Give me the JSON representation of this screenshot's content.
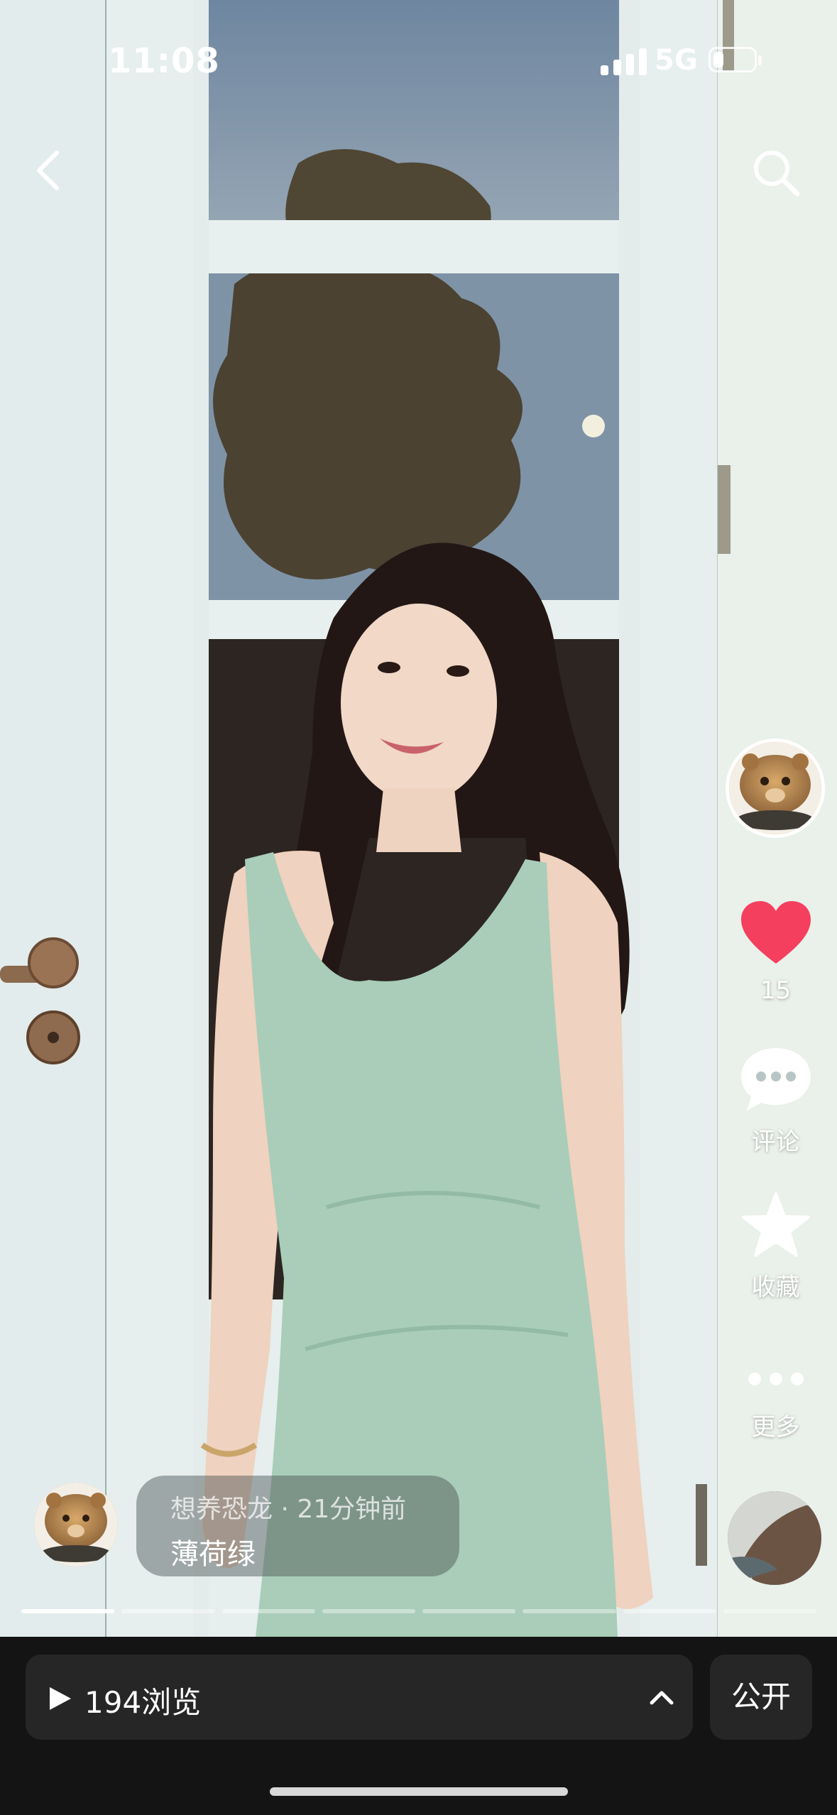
{
  "status_bar": {
    "time": "11:08",
    "network": "5G",
    "battery_level": 0.2
  },
  "post": {
    "author": "想养恐龙",
    "time_ago": "21分钟前",
    "meta_line": "想养恐龙 · 21分钟前",
    "title": "薄荷绿",
    "segments_total": 8,
    "segment_active": 1
  },
  "actions": {
    "like_count": "15",
    "comment_label": "评论",
    "favorite_label": "收藏",
    "more_label": "更多"
  },
  "bottom_bar": {
    "views_label": "194浏览",
    "visibility_label": "公开"
  },
  "colors": {
    "like": "#f43f5e",
    "bar_bg": "#141414",
    "pill_bg": "#262626",
    "dress": "#a9cdb8"
  },
  "icons": [
    "back-icon",
    "search-icon",
    "heart-icon",
    "comment-icon",
    "star-icon",
    "more-icon",
    "play-icon",
    "chevron-up-icon"
  ]
}
